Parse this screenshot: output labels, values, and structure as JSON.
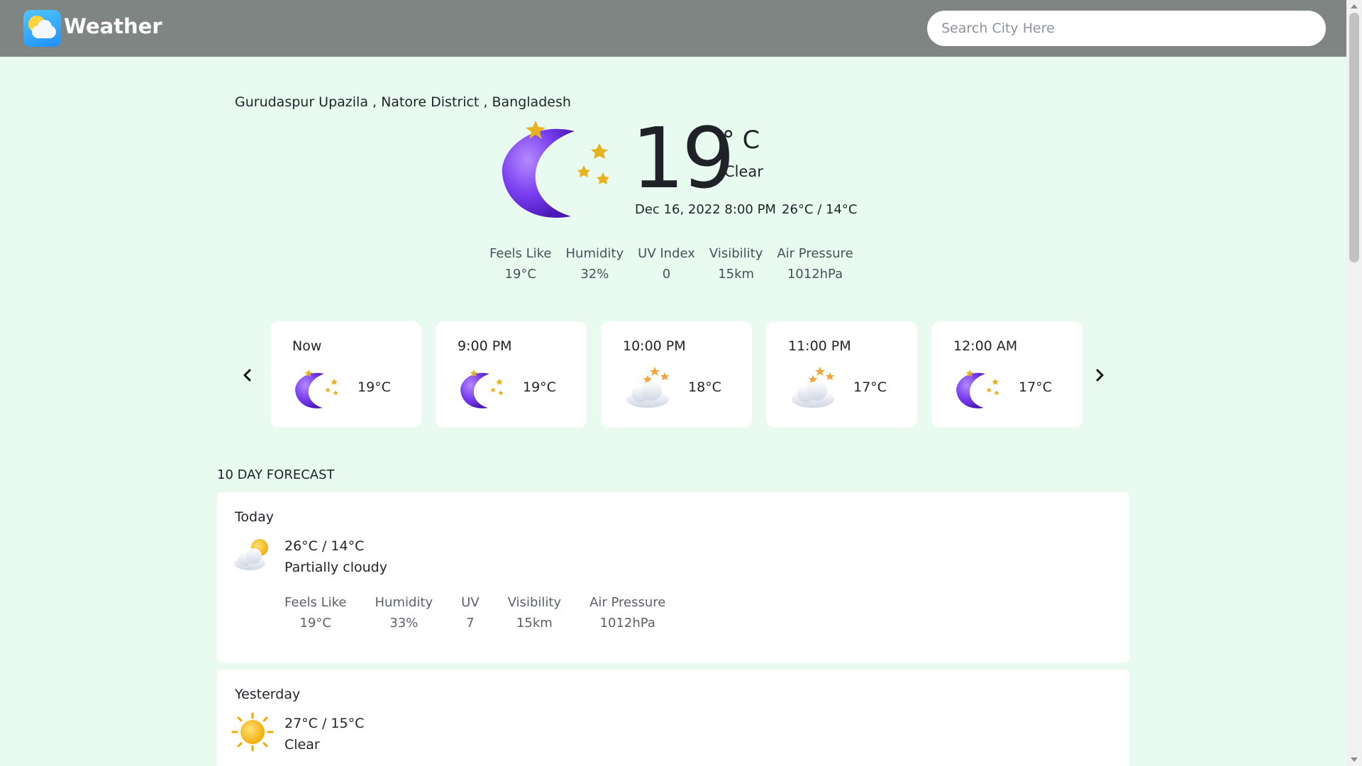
{
  "header": {
    "app_title": "Weather",
    "search_placeholder": "Search City Here",
    "logo_icon": "weather-app-logo-icon"
  },
  "current": {
    "location": "Gurudaspur Upazila , Natore District , Bangladesh",
    "icon": "moon-stars-icon",
    "temperature": "19",
    "unit": "° C",
    "condition": "Clear",
    "datetime": "Dec 16, 2022 8:00 PM",
    "high_low": "26°C / 14°C",
    "stats": [
      {
        "label": "Feels Like",
        "value": "19°C"
      },
      {
        "label": "Humidity",
        "value": "32%"
      },
      {
        "label": "UV Index",
        "value": "0"
      },
      {
        "label": "Visibility",
        "value": "15km"
      },
      {
        "label": "Air Pressure",
        "value": "1012hPa"
      }
    ]
  },
  "hourly": [
    {
      "time": "Now",
      "temp": "19°C",
      "icon": "moon-stars-icon"
    },
    {
      "time": "9:00 PM",
      "temp": "19°C",
      "icon": "moon-stars-icon"
    },
    {
      "time": "10:00 PM",
      "temp": "18°C",
      "icon": "cloud-stars-icon"
    },
    {
      "time": "11:00 PM",
      "temp": "17°C",
      "icon": "cloud-stars-icon"
    },
    {
      "time": "12:00 AM",
      "temp": "17°C",
      "icon": "moon-stars-icon"
    }
  ],
  "forecast": {
    "title": "10 DAY FORECAST",
    "days": [
      {
        "day": "Today",
        "icon": "partly-cloudy-icon",
        "high_low": "26°C / 14°C",
        "condition": "Partially cloudy",
        "stats": [
          {
            "label": "Feels Like",
            "value": "19°C"
          },
          {
            "label": "Humidity",
            "value": "33%"
          },
          {
            "label": "UV",
            "value": "7"
          },
          {
            "label": "Visibility",
            "value": "15km"
          },
          {
            "label": "Air Pressure",
            "value": "1012hPa"
          }
        ]
      },
      {
        "day": "Yesterday",
        "icon": "sun-icon",
        "high_low": "27°C / 15°C",
        "condition": "Clear"
      }
    ]
  },
  "colors": {
    "page_bg": "#e9fbf1",
    "header_bg": "#7e8582",
    "moon": "#7b3ee6",
    "star": "#e8b21f"
  }
}
